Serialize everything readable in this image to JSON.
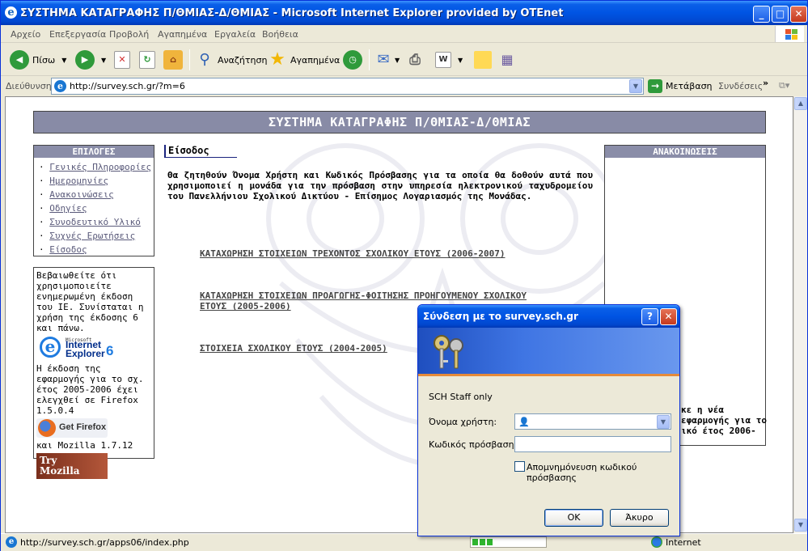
{
  "window": {
    "title": "ΣΥΣΤΗΜΑ ΚΑΤΑΓΡΑΦΗΣ Π/ΘΜΙΑΣ-Δ/ΘΜΙΑΣ - Microsoft Internet Explorer provided by OTEnet"
  },
  "menubar": [
    "Αρχείο",
    "Επεξεργασία",
    "Προβολή",
    "Αγαπημένα",
    "Εργαλεία",
    "Βοήθεια"
  ],
  "toolbar": {
    "back_label": "Πίσω",
    "search_label": "Αναζήτηση",
    "favorites_label": "Αγαπημένα"
  },
  "address": {
    "label": "Διεύθυνση",
    "url": "http://survey.sch.gr/?m=6",
    "go_label": "Μετάβαση",
    "links_label": "Συνδέσεις"
  },
  "page": {
    "header": "ΣΥΣΤΗΜΑ ΚΑΤΑΓΡΑΦΗΣ Π/ΘΜΙΑΣ-Δ/ΘΜΙΑΣ",
    "options_title": "ΕΠΙΛΟΓΕΣ",
    "options": [
      "Γενικές Πληροφορίες",
      "Ημερομηνίες",
      "Ανακοινώσεις",
      "Οδηγίες",
      "Συνοδευτικό Υλικό",
      "Συχνές Ερωτήσεις",
      "Είσοδος"
    ],
    "browser_note": "Βεβαιωθείτε ότι χρησιμοποιείτε ενημερωμένη έκδοση του IE. Συνίσταται η χρήση της έκδοσης 6 και πάνω.",
    "ie_badge_small": "Microsoft",
    "ie_badge_line1": "Internet",
    "ie_badge_line2": "Explorer",
    "ie_badge_ver": "6",
    "app_note": "Η έκδοση της εφαρμογής για το σχ. έτος 2005-2006 έχει ελεγχθεί σε Firefox 1.5.0.4",
    "firefox_badge": "Get Firefox",
    "mozilla_note": "και Mozilla 1.7.12",
    "mozilla_badge_line1": "Try",
    "mozilla_badge_line2": "Mozilla",
    "section_title": "Είσοδος",
    "intro": "Θα ζητηθούν Όνομα Χρήστη και Κωδικός Πρόσβασης για τα οποία θα δοθούν αυτά που χρησιμοποιεί η μονάδα για την πρόσβαση στην υπηρεσία ηλεκτρονικού ταχυδρομείου του Πανελλήνιου Σχολικού Δικτύου - Επίσημος Λογαριασμός της Μονάδας.",
    "links": [
      "ΚΑΤΑΧΩΡΗΣΗ ΣΤΟΙΧΕΙΩΝ ΤΡΕΧΟΝΤΟΣ ΣΧΟΛΙΚΟΥ ΕΤΟΥΣ (2006-2007)",
      "ΚΑΤΑΧΩΡΗΣΗ ΣΤΟΙΧΕΙΩΝ ΠΡΟΑΓΩΓΗΣ-ΦΟΙΤΗΣΗΣ ΠΡΟΗΓΟΥΜΕΝΟΥ ΣΧΟΛΙΚΟΥ ΕΤΟΥΣ (2005-2006)",
      "ΣΤΟΙΧΕΙΑ ΣΧΟΛΙΚΟΥ ΕΤΟΥΣ (2004-2005)"
    ],
    "announcements_title": "ΑΝΑΚΟΙΝΩΣΕΙΣ",
    "announcement_fragment": [
      "κε η νέα",
      "εφαρμογής για το",
      "ικό έτος 2006-"
    ]
  },
  "dialog": {
    "title": "Σύνδεση με το survey.sch.gr",
    "realm": "SCH Staff only",
    "username_label": "Όνομα χρήστη:",
    "username_value": "",
    "password_label": "Κωδικός πρόσβασης:",
    "password_value": "",
    "remember_label": "Απομνημόνευση κωδικού πρόσβασης",
    "remember_checked": false,
    "ok_label": "OK",
    "cancel_label": "Άκυρο",
    "help_glyph": "?",
    "close_glyph": "✕"
  },
  "statusbar": {
    "url": "http://survey.sch.gr/apps06/index.php",
    "progress": 0.3,
    "zone": "Internet"
  }
}
